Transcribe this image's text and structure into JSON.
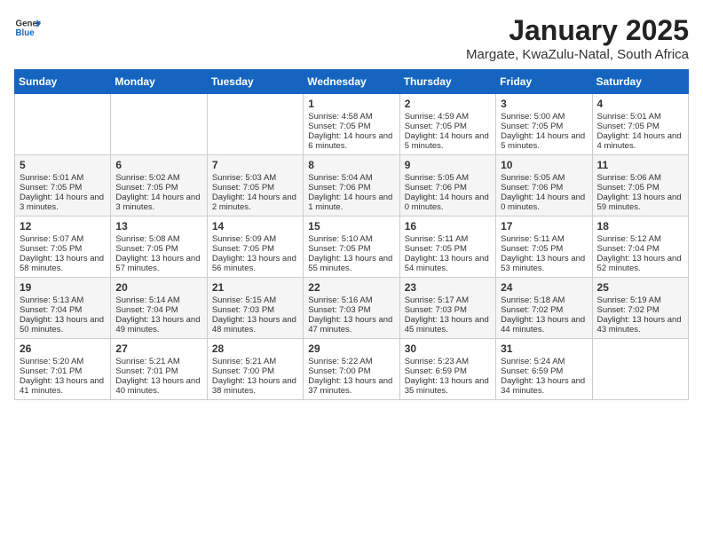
{
  "logo": {
    "line1": "General",
    "line2": "Blue"
  },
  "title": "January 2025",
  "subtitle": "Margate, KwaZulu-Natal, South Africa",
  "headers": [
    "Sunday",
    "Monday",
    "Tuesday",
    "Wednesday",
    "Thursday",
    "Friday",
    "Saturday"
  ],
  "weeks": [
    {
      "days": [
        {
          "num": "",
          "data": ""
        },
        {
          "num": "",
          "data": ""
        },
        {
          "num": "",
          "data": ""
        },
        {
          "num": "1",
          "data": "Sunrise: 4:58 AM\nSunset: 7:05 PM\nDaylight: 14 hours and 6 minutes."
        },
        {
          "num": "2",
          "data": "Sunrise: 4:59 AM\nSunset: 7:05 PM\nDaylight: 14 hours and 5 minutes."
        },
        {
          "num": "3",
          "data": "Sunrise: 5:00 AM\nSunset: 7:05 PM\nDaylight: 14 hours and 5 minutes."
        },
        {
          "num": "4",
          "data": "Sunrise: 5:01 AM\nSunset: 7:05 PM\nDaylight: 14 hours and 4 minutes."
        }
      ]
    },
    {
      "days": [
        {
          "num": "5",
          "data": "Sunrise: 5:01 AM\nSunset: 7:05 PM\nDaylight: 14 hours and 3 minutes."
        },
        {
          "num": "6",
          "data": "Sunrise: 5:02 AM\nSunset: 7:05 PM\nDaylight: 14 hours and 3 minutes."
        },
        {
          "num": "7",
          "data": "Sunrise: 5:03 AM\nSunset: 7:05 PM\nDaylight: 14 hours and 2 minutes."
        },
        {
          "num": "8",
          "data": "Sunrise: 5:04 AM\nSunset: 7:06 PM\nDaylight: 14 hours and 1 minute."
        },
        {
          "num": "9",
          "data": "Sunrise: 5:05 AM\nSunset: 7:06 PM\nDaylight: 14 hours and 0 minutes."
        },
        {
          "num": "10",
          "data": "Sunrise: 5:05 AM\nSunset: 7:06 PM\nDaylight: 14 hours and 0 minutes."
        },
        {
          "num": "11",
          "data": "Sunrise: 5:06 AM\nSunset: 7:05 PM\nDaylight: 13 hours and 59 minutes."
        }
      ]
    },
    {
      "days": [
        {
          "num": "12",
          "data": "Sunrise: 5:07 AM\nSunset: 7:05 PM\nDaylight: 13 hours and 58 minutes."
        },
        {
          "num": "13",
          "data": "Sunrise: 5:08 AM\nSunset: 7:05 PM\nDaylight: 13 hours and 57 minutes."
        },
        {
          "num": "14",
          "data": "Sunrise: 5:09 AM\nSunset: 7:05 PM\nDaylight: 13 hours and 56 minutes."
        },
        {
          "num": "15",
          "data": "Sunrise: 5:10 AM\nSunset: 7:05 PM\nDaylight: 13 hours and 55 minutes."
        },
        {
          "num": "16",
          "data": "Sunrise: 5:11 AM\nSunset: 7:05 PM\nDaylight: 13 hours and 54 minutes."
        },
        {
          "num": "17",
          "data": "Sunrise: 5:11 AM\nSunset: 7:05 PM\nDaylight: 13 hours and 53 minutes."
        },
        {
          "num": "18",
          "data": "Sunrise: 5:12 AM\nSunset: 7:04 PM\nDaylight: 13 hours and 52 minutes."
        }
      ]
    },
    {
      "days": [
        {
          "num": "19",
          "data": "Sunrise: 5:13 AM\nSunset: 7:04 PM\nDaylight: 13 hours and 50 minutes."
        },
        {
          "num": "20",
          "data": "Sunrise: 5:14 AM\nSunset: 7:04 PM\nDaylight: 13 hours and 49 minutes."
        },
        {
          "num": "21",
          "data": "Sunrise: 5:15 AM\nSunset: 7:03 PM\nDaylight: 13 hours and 48 minutes."
        },
        {
          "num": "22",
          "data": "Sunrise: 5:16 AM\nSunset: 7:03 PM\nDaylight: 13 hours and 47 minutes."
        },
        {
          "num": "23",
          "data": "Sunrise: 5:17 AM\nSunset: 7:03 PM\nDaylight: 13 hours and 45 minutes."
        },
        {
          "num": "24",
          "data": "Sunrise: 5:18 AM\nSunset: 7:02 PM\nDaylight: 13 hours and 44 minutes."
        },
        {
          "num": "25",
          "data": "Sunrise: 5:19 AM\nSunset: 7:02 PM\nDaylight: 13 hours and 43 minutes."
        }
      ]
    },
    {
      "days": [
        {
          "num": "26",
          "data": "Sunrise: 5:20 AM\nSunset: 7:01 PM\nDaylight: 13 hours and 41 minutes."
        },
        {
          "num": "27",
          "data": "Sunrise: 5:21 AM\nSunset: 7:01 PM\nDaylight: 13 hours and 40 minutes."
        },
        {
          "num": "28",
          "data": "Sunrise: 5:21 AM\nSunset: 7:00 PM\nDaylight: 13 hours and 38 minutes."
        },
        {
          "num": "29",
          "data": "Sunrise: 5:22 AM\nSunset: 7:00 PM\nDaylight: 13 hours and 37 minutes."
        },
        {
          "num": "30",
          "data": "Sunrise: 5:23 AM\nSunset: 6:59 PM\nDaylight: 13 hours and 35 minutes."
        },
        {
          "num": "31",
          "data": "Sunrise: 5:24 AM\nSunset: 6:59 PM\nDaylight: 13 hours and 34 minutes."
        },
        {
          "num": "",
          "data": ""
        }
      ]
    }
  ]
}
